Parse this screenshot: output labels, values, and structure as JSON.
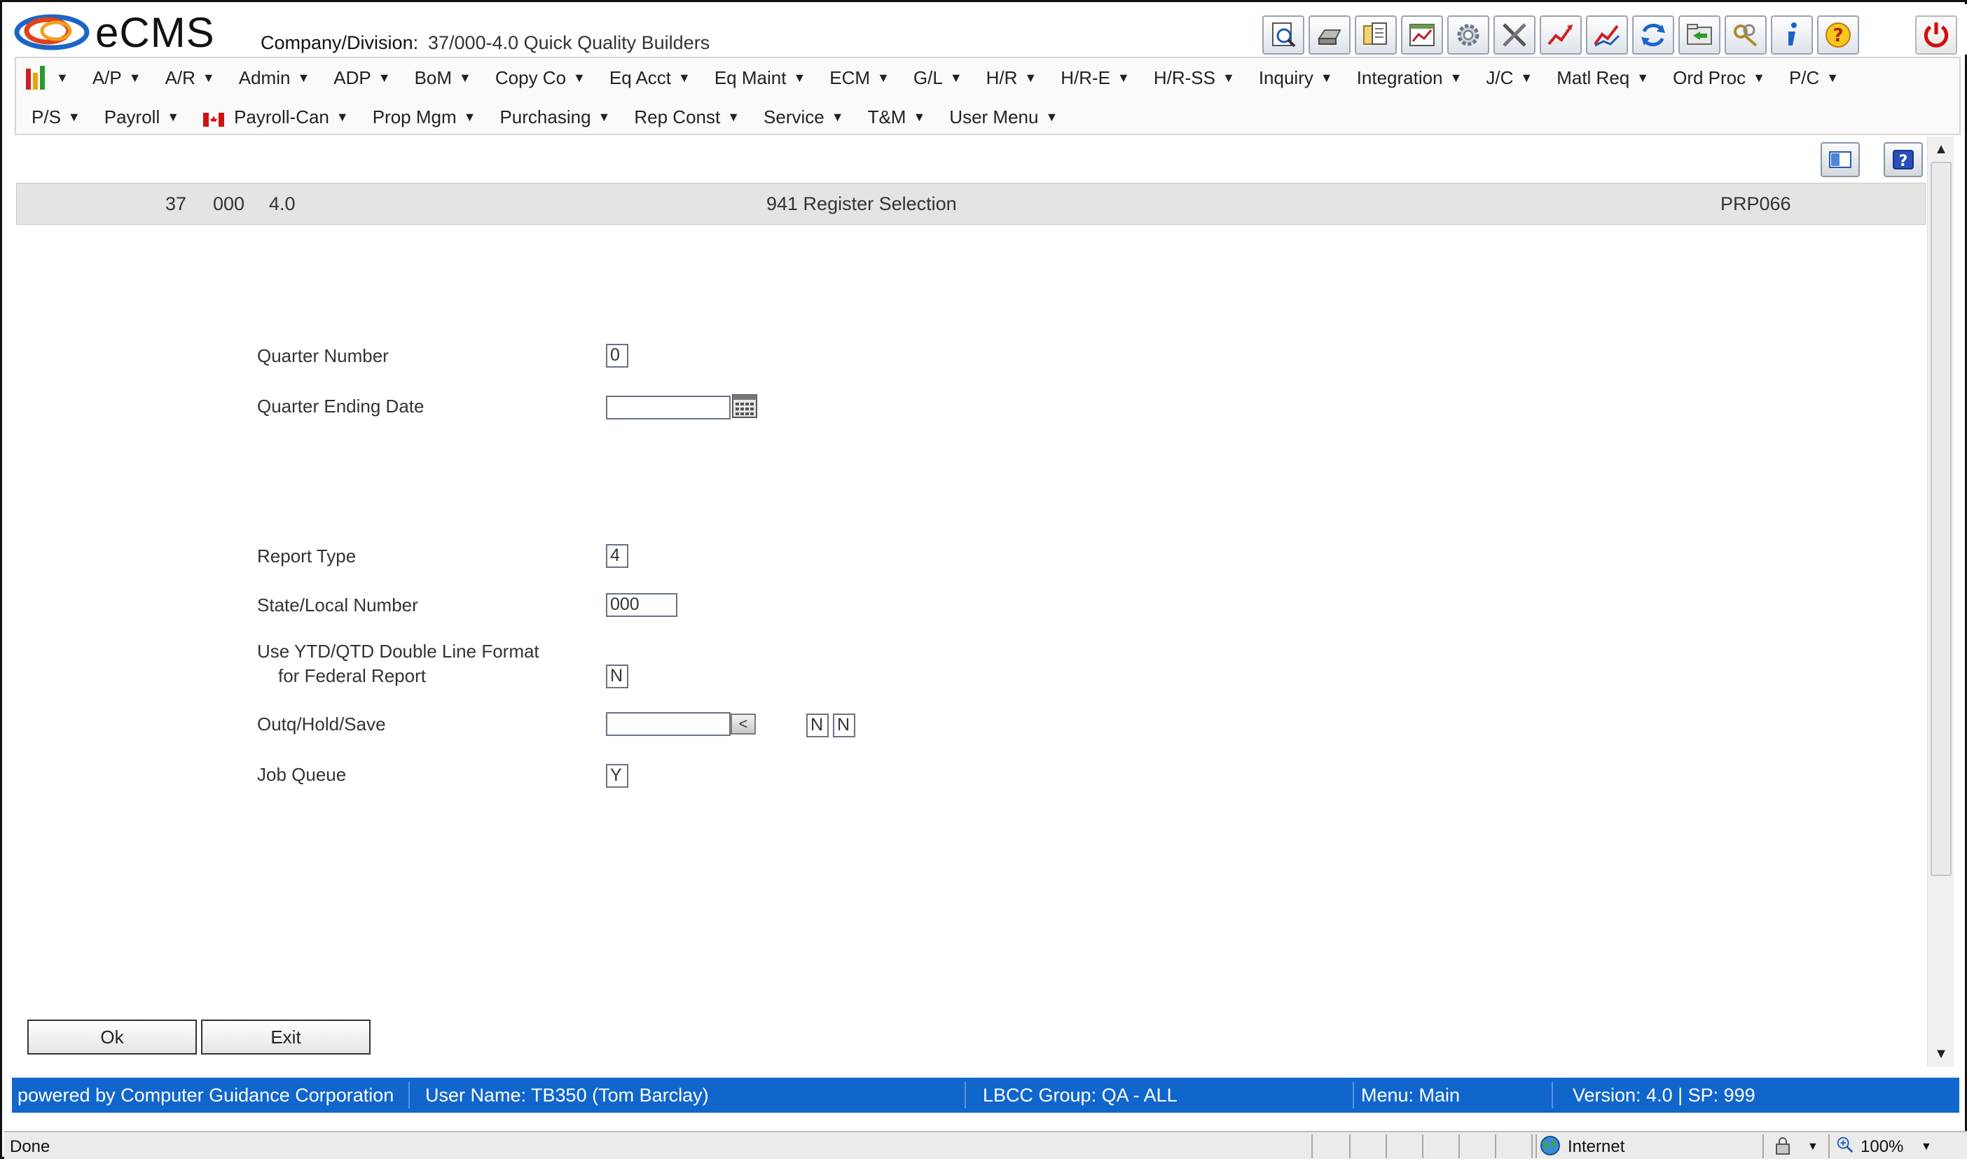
{
  "header": {
    "brand": "eCMS",
    "company_label": "Company/Division:",
    "company_value": "37/000-4.0 Quick Quality Builders"
  },
  "toolbar": {
    "icons": [
      "search-page-icon",
      "printer-icon",
      "documents-icon",
      "spreadsheet-icon",
      "gear-icon",
      "tools-icon",
      "trend-up-icon",
      "trend-chart-icon",
      "refresh-icon",
      "folder-transfer-icon",
      "keys-icon",
      "info-icon",
      "help-icon",
      "power-icon"
    ]
  },
  "menu": {
    "row1": [
      {
        "label": "A/P"
      },
      {
        "label": "A/R"
      },
      {
        "label": "Admin"
      },
      {
        "label": "ADP"
      },
      {
        "label": "BoM"
      },
      {
        "label": "Copy Co"
      },
      {
        "label": "Eq Acct"
      },
      {
        "label": "Eq Maint"
      },
      {
        "label": "ECM"
      },
      {
        "label": "G/L"
      },
      {
        "label": "H/R"
      },
      {
        "label": "H/R-E"
      },
      {
        "label": "H/R-SS"
      },
      {
        "label": "Inquiry"
      },
      {
        "label": "Integration"
      },
      {
        "label": "J/C"
      },
      {
        "label": "Matl Req"
      },
      {
        "label": "Ord Proc"
      },
      {
        "label": "P/C"
      }
    ],
    "row2": [
      {
        "label": "P/S"
      },
      {
        "label": "Payroll"
      },
      {
        "label": "Payroll-Can"
      },
      {
        "label": "Prop Mgm"
      },
      {
        "label": "Purchasing"
      },
      {
        "label": "Rep Const"
      },
      {
        "label": "Service"
      },
      {
        "label": "T&M"
      },
      {
        "label": "User Menu"
      }
    ],
    "arrow": "▼"
  },
  "title_bar": {
    "company": "37",
    "division": "000",
    "version": "4.0",
    "title": "941 Register Selection",
    "program": "PRP066"
  },
  "form": {
    "quarter_number": {
      "label": "Quarter Number",
      "value": "0"
    },
    "quarter_ending_date": {
      "label": "Quarter Ending Date",
      "value": ""
    },
    "report_type": {
      "label": "Report Type",
      "value": "4"
    },
    "state_local_number": {
      "label": "State/Local Number",
      "value": "000"
    },
    "ytd_format": {
      "label_line1": "Use YTD/QTD Double Line Format",
      "label_line2": "for Federal Report",
      "value": "N"
    },
    "outq": {
      "label": "Outq/Hold/Save",
      "value": "",
      "lookup": "<",
      "hold": "N",
      "save": "N"
    },
    "job_queue": {
      "label": "Job Queue",
      "value": "Y"
    }
  },
  "buttons": {
    "ok": "Ok",
    "exit": "Exit"
  },
  "statusbar": {
    "powered": "powered by Computer Guidance Corporation",
    "user": "User Name:  TB350 (Tom Barclay)",
    "group": "LBCC Group:  QA - ALL",
    "menu": "Menu:  Main",
    "version": "Version: 4.0 | SP: 999"
  },
  "browser_status": {
    "state": "Done",
    "zone": "Internet",
    "zoom": "100%"
  }
}
